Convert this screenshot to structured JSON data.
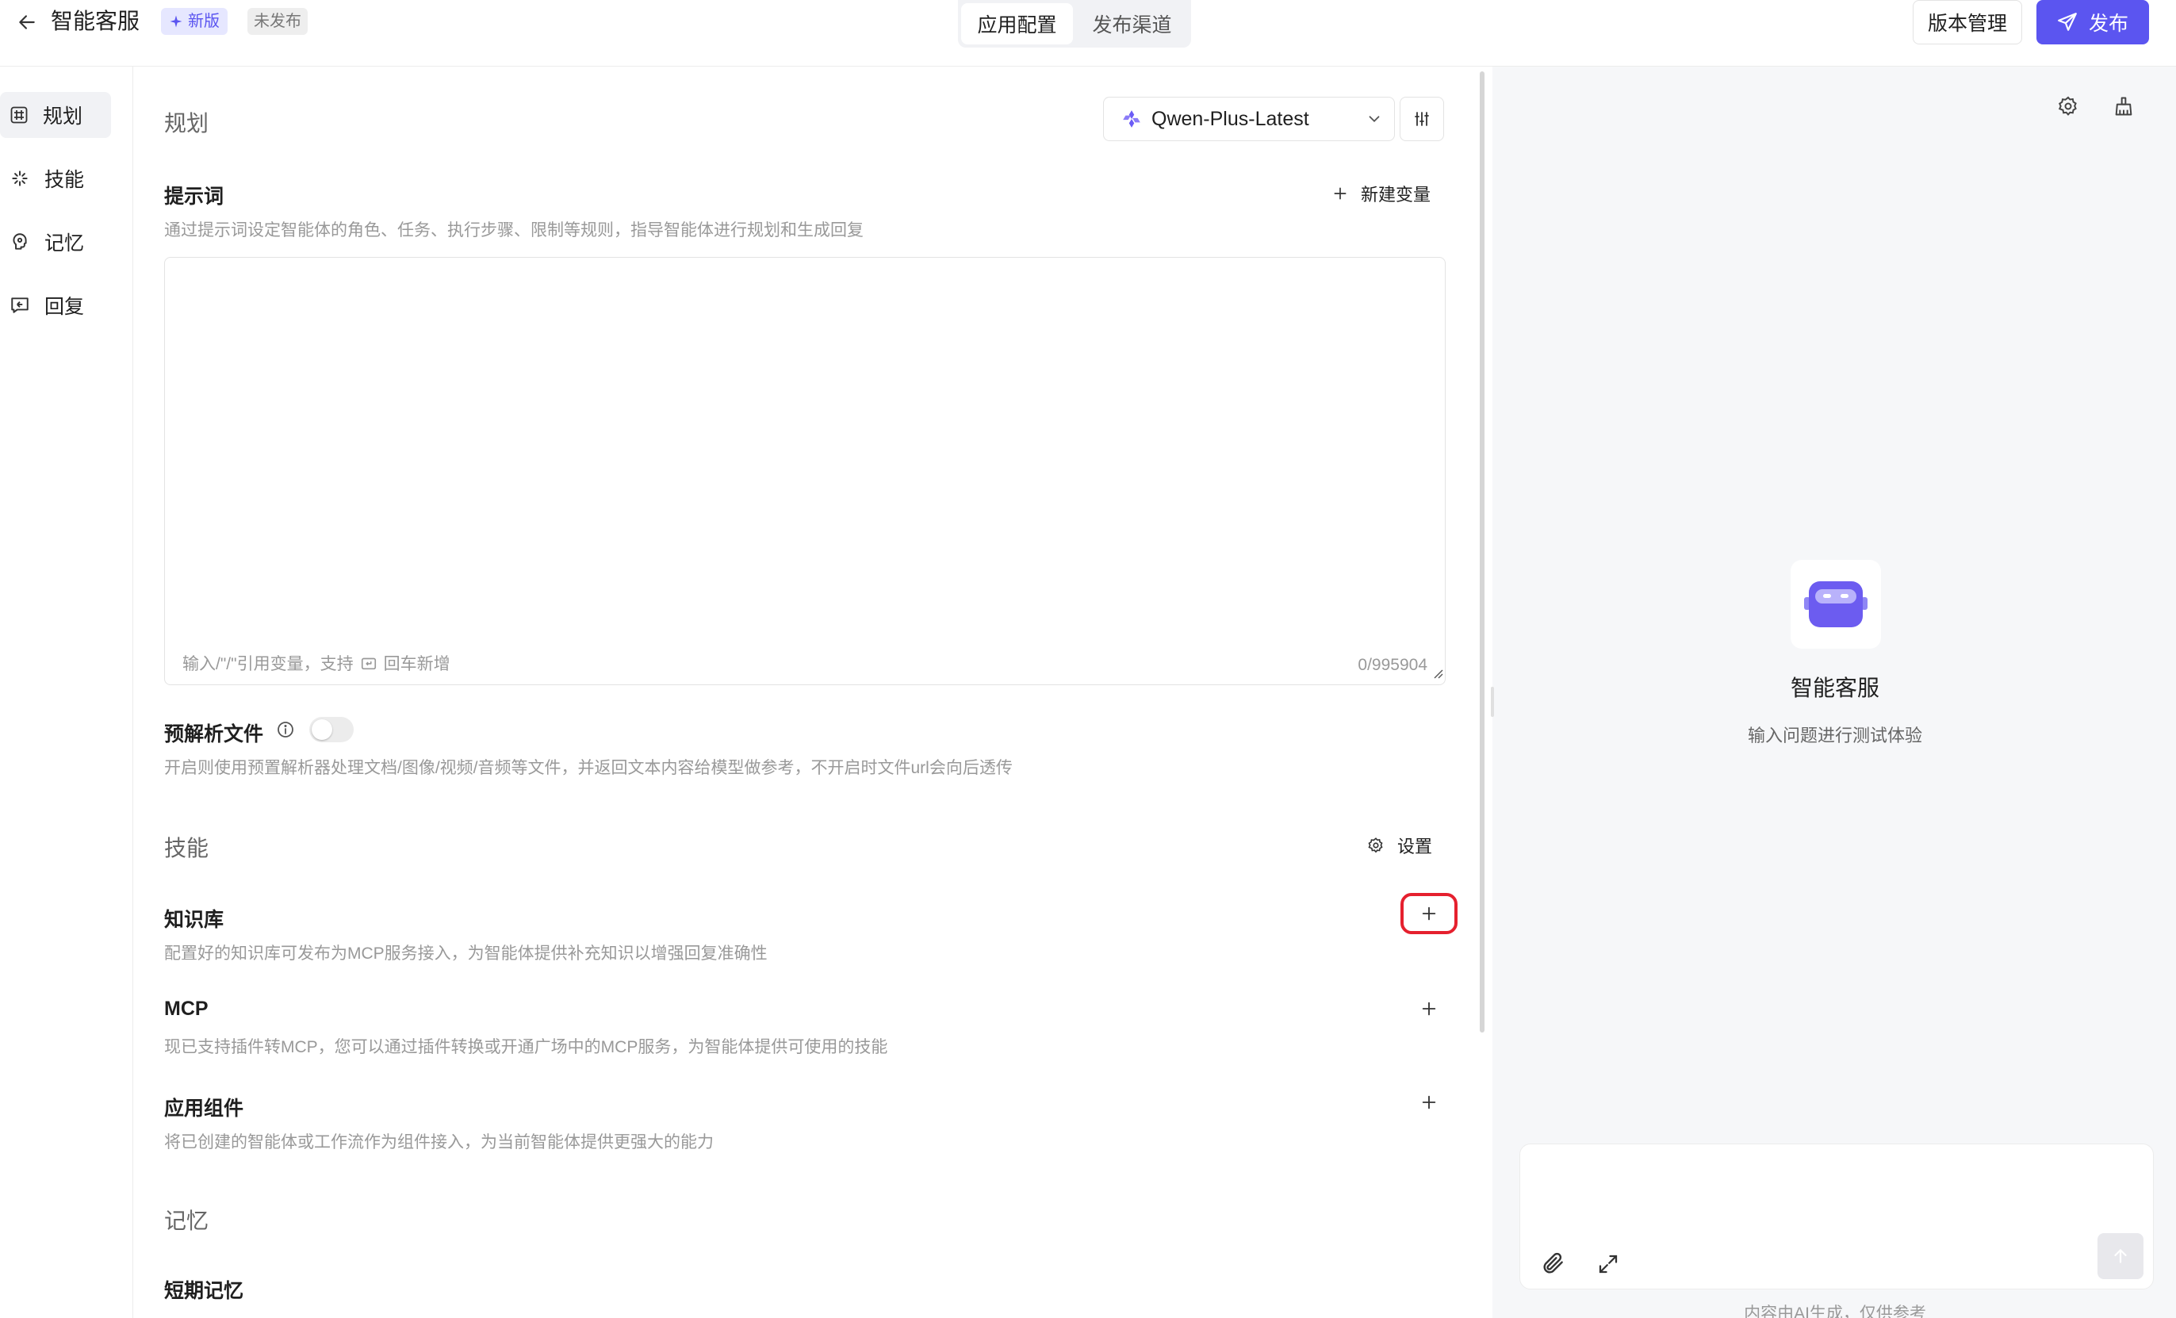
{
  "header": {
    "back_icon": "arrow-left-icon",
    "app_title": "智能客服",
    "badge_new": "新版",
    "badge_status": "未发布",
    "tabs": [
      {
        "label": "应用配置",
        "active": true
      },
      {
        "label": "发布渠道",
        "active": false
      }
    ],
    "version_button": "版本管理",
    "publish_button": "发布",
    "accent_color": "#5b55f0"
  },
  "sidebar": {
    "items": [
      {
        "label": "规划",
        "icon": "hash-icon",
        "active": true
      },
      {
        "label": "技能",
        "icon": "sparkle-icon",
        "active": false
      },
      {
        "label": "记忆",
        "icon": "brain-icon",
        "active": false
      },
      {
        "label": "回复",
        "icon": "chat-reply-icon",
        "active": false
      }
    ]
  },
  "main": {
    "planning_title": "规划",
    "model_name": "Qwen-Plus-Latest",
    "prompt": {
      "title": "提示词",
      "new_variable": "新建变量",
      "description": "通过提示词设定智能体的角色、任务、执行步骤、限制等规则，指导智能体进行规划和生成回复",
      "placeholder_prefix": "输入/\"/\"引用变量，支持",
      "placeholder_suffix": "回车新增",
      "counter": "0/995904"
    },
    "preparse": {
      "title": "预解析文件",
      "enabled": false,
      "description": "开启则使用预置解析器处理文档/图像/视频/音频等文件，并返回文本内容给模型做参考，不开启时文件url会向后透传"
    },
    "skills_title": "技能",
    "skills_settings": "设置",
    "knowledge": {
      "title": "知识库",
      "description": "配置好的知识库可发布为MCP服务接入，为智能体提供补充知识以增强回复准确性"
    },
    "mcp": {
      "title": "MCP",
      "description": "现已支持插件转MCP，您可以通过插件转换或开通广场中的MCP服务，为智能体提供可使用的技能"
    },
    "components": {
      "title": "应用组件",
      "description": "将已创建的智能体或工作流作为组件接入，为当前智能体提供更强大的能力"
    },
    "memory_title": "记忆",
    "short_memory": {
      "title": "短期记忆"
    }
  },
  "preview": {
    "bot_name": "智能客服",
    "bot_hint": "输入问题进行测试体验",
    "disclaimer": "内容由AI生成，仅供参考"
  }
}
